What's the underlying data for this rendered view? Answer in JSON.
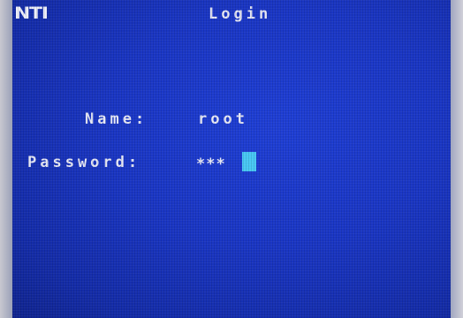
{
  "header": {
    "logo_text": "NTI",
    "title": "Login"
  },
  "form": {
    "name_label": "Name:",
    "name_value": "root",
    "password_label": "Password:",
    "password_value": "***"
  },
  "colors": {
    "screen_background": "#1a36c4",
    "text": "#e6e8f6",
    "cursor": "#48c8f4"
  }
}
